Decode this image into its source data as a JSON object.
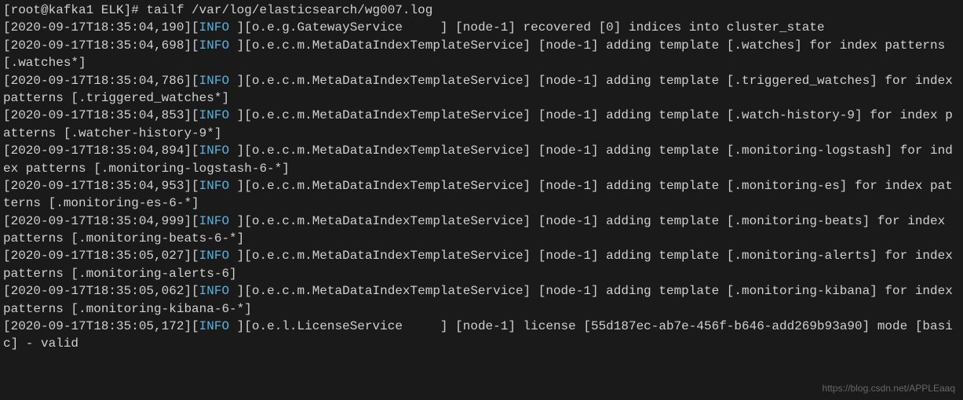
{
  "prompt": {
    "userhost": "[root@kafka1 ELK]# ",
    "command": "tailf /var/log/elasticsearch/wg007.log"
  },
  "logs": [
    {
      "ts": "[2020-09-17T18:35:04,190]",
      "level": "INFO ",
      "logger": "[o.e.g.GatewayService     ]",
      "msg": " [node-1] recovered [0] indices into cluster_state"
    },
    {
      "ts": "[2020-09-17T18:35:04,698]",
      "level": "INFO ",
      "logger": "[o.e.c.m.MetaDataIndexTemplateService]",
      "msg": " [node-1] adding template [.watches] for index patterns [.watches*]"
    },
    {
      "ts": "[2020-09-17T18:35:04,786]",
      "level": "INFO ",
      "logger": "[o.e.c.m.MetaDataIndexTemplateService]",
      "msg": " [node-1] adding template [.triggered_watches] for index patterns [.triggered_watches*]"
    },
    {
      "ts": "[2020-09-17T18:35:04,853]",
      "level": "INFO ",
      "logger": "[o.e.c.m.MetaDataIndexTemplateService]",
      "msg": " [node-1] adding template [.watch-history-9] for index patterns [.watcher-history-9*]"
    },
    {
      "ts": "[2020-09-17T18:35:04,894]",
      "level": "INFO ",
      "logger": "[o.e.c.m.MetaDataIndexTemplateService]",
      "msg": " [node-1] adding template [.monitoring-logstash] for index patterns [.monitoring-logstash-6-*]"
    },
    {
      "ts": "[2020-09-17T18:35:04,953]",
      "level": "INFO ",
      "logger": "[o.e.c.m.MetaDataIndexTemplateService]",
      "msg": " [node-1] adding template [.monitoring-es] for index patterns [.monitoring-es-6-*]"
    },
    {
      "ts": "[2020-09-17T18:35:04,999]",
      "level": "INFO ",
      "logger": "[o.e.c.m.MetaDataIndexTemplateService]",
      "msg": " [node-1] adding template [.monitoring-beats] for index patterns [.monitoring-beats-6-*]"
    },
    {
      "ts": "[2020-09-17T18:35:05,027]",
      "level": "INFO ",
      "logger": "[o.e.c.m.MetaDataIndexTemplateService]",
      "msg": " [node-1] adding template [.monitoring-alerts] for index patterns [.monitoring-alerts-6]"
    },
    {
      "ts": "[2020-09-17T18:35:05,062]",
      "level": "INFO ",
      "logger": "[o.e.c.m.MetaDataIndexTemplateService]",
      "msg": " [node-1] adding template [.monitoring-kibana] for index patterns [.monitoring-kibana-6-*]"
    },
    {
      "ts": "[2020-09-17T18:35:05,172]",
      "level": "INFO ",
      "logger": "[o.e.l.LicenseService     ]",
      "msg": " [node-1] license [55d187ec-ab7e-456f-b646-add269b93a90] mode [basic] - valid"
    }
  ],
  "watermark": "https://blog.csdn.net/APPLEaaq"
}
